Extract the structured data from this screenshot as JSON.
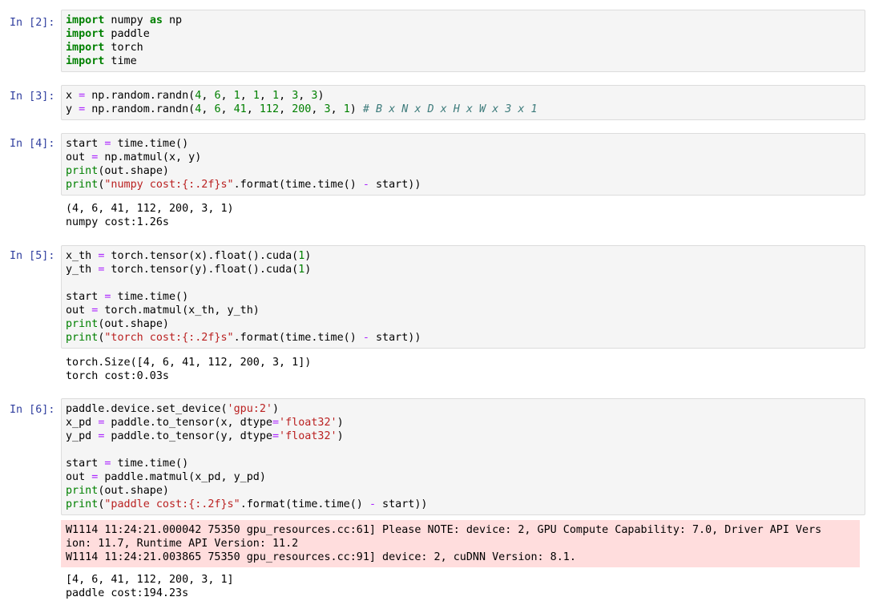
{
  "cells": [
    {
      "prompt": "In [2]:",
      "lines": [
        [
          [
            "kw",
            "import"
          ],
          [
            "t",
            " numpy "
          ],
          [
            "kw",
            "as"
          ],
          [
            "t",
            " np"
          ]
        ],
        [
          [
            "kw",
            "import"
          ],
          [
            "t",
            " paddle"
          ]
        ],
        [
          [
            "kw",
            "import"
          ],
          [
            "t",
            " torch"
          ]
        ],
        [
          [
            "kw",
            "import"
          ],
          [
            "t",
            " time"
          ]
        ]
      ],
      "output": [],
      "stderr": []
    },
    {
      "prompt": "In [3]:",
      "lines": [
        [
          [
            "t",
            "x "
          ],
          [
            "op",
            "="
          ],
          [
            "t",
            " np.random.randn("
          ],
          [
            "num",
            "4"
          ],
          [
            "t",
            ", "
          ],
          [
            "num",
            "6"
          ],
          [
            "t",
            ", "
          ],
          [
            "num",
            "1"
          ],
          [
            "t",
            ", "
          ],
          [
            "num",
            "1"
          ],
          [
            "t",
            ", "
          ],
          [
            "num",
            "1"
          ],
          [
            "t",
            ", "
          ],
          [
            "num",
            "3"
          ],
          [
            "t",
            ", "
          ],
          [
            "num",
            "3"
          ],
          [
            "t",
            ")"
          ]
        ],
        [
          [
            "t",
            "y "
          ],
          [
            "op",
            "="
          ],
          [
            "t",
            " np.random.randn("
          ],
          [
            "num",
            "4"
          ],
          [
            "t",
            ", "
          ],
          [
            "num",
            "6"
          ],
          [
            "t",
            ", "
          ],
          [
            "num",
            "41"
          ],
          [
            "t",
            ", "
          ],
          [
            "num",
            "112"
          ],
          [
            "t",
            ", "
          ],
          [
            "num",
            "200"
          ],
          [
            "t",
            ", "
          ],
          [
            "num",
            "3"
          ],
          [
            "t",
            ", "
          ],
          [
            "num",
            "1"
          ],
          [
            "t",
            ") "
          ],
          [
            "cm",
            "# B x N x D x H x W x 3 x 1"
          ]
        ]
      ],
      "output": [],
      "stderr": []
    },
    {
      "prompt": "In [4]:",
      "lines": [
        [
          [
            "t",
            "start "
          ],
          [
            "op",
            "="
          ],
          [
            "t",
            " time.time()"
          ]
        ],
        [
          [
            "t",
            "out "
          ],
          [
            "op",
            "="
          ],
          [
            "t",
            " np.matmul(x, y)"
          ]
        ],
        [
          [
            "bi",
            "print"
          ],
          [
            "t",
            "(out.shape)"
          ]
        ],
        [
          [
            "bi",
            "print"
          ],
          [
            "t",
            "("
          ],
          [
            "str",
            "\"numpy cost:{:.2f}s\""
          ],
          [
            "t",
            ".format(time.time() "
          ],
          [
            "op",
            "-"
          ],
          [
            "t",
            " start))"
          ]
        ]
      ],
      "output": [
        "(4, 6, 41, 112, 200, 3, 1)",
        "numpy cost:1.26s"
      ],
      "stderr": []
    },
    {
      "prompt": "In [5]:",
      "lines": [
        [
          [
            "t",
            "x_th "
          ],
          [
            "op",
            "="
          ],
          [
            "t",
            " torch.tensor(x).float().cuda("
          ],
          [
            "num",
            "1"
          ],
          [
            "t",
            ")"
          ]
        ],
        [
          [
            "t",
            "y_th "
          ],
          [
            "op",
            "="
          ],
          [
            "t",
            " torch.tensor(y).float().cuda("
          ],
          [
            "num",
            "1"
          ],
          [
            "t",
            ")"
          ]
        ],
        [
          [
            "t",
            ""
          ]
        ],
        [
          [
            "t",
            "start "
          ],
          [
            "op",
            "="
          ],
          [
            "t",
            " time.time()"
          ]
        ],
        [
          [
            "t",
            "out "
          ],
          [
            "op",
            "="
          ],
          [
            "t",
            " torch.matmul(x_th, y_th)"
          ]
        ],
        [
          [
            "bi",
            "print"
          ],
          [
            "t",
            "(out.shape)"
          ]
        ],
        [
          [
            "bi",
            "print"
          ],
          [
            "t",
            "("
          ],
          [
            "str",
            "\"torch cost:{:.2f}s\""
          ],
          [
            "t",
            ".format(time.time() "
          ],
          [
            "op",
            "-"
          ],
          [
            "t",
            " start))"
          ]
        ]
      ],
      "output": [
        "torch.Size([4, 6, 41, 112, 200, 3, 1])",
        "torch cost:0.03s"
      ],
      "stderr": []
    },
    {
      "prompt": "In [6]:",
      "lines": [
        [
          [
            "t",
            "paddle.device.set_device("
          ],
          [
            "str",
            "'gpu:2'"
          ],
          [
            "t",
            ")"
          ]
        ],
        [
          [
            "t",
            "x_pd "
          ],
          [
            "op",
            "="
          ],
          [
            "t",
            " paddle.to_tensor(x, dtype"
          ],
          [
            "op",
            "="
          ],
          [
            "str",
            "'float32'"
          ],
          [
            "t",
            ")"
          ]
        ],
        [
          [
            "t",
            "y_pd "
          ],
          [
            "op",
            "="
          ],
          [
            "t",
            " paddle.to_tensor(y, dtype"
          ],
          [
            "op",
            "="
          ],
          [
            "str",
            "'float32'"
          ],
          [
            "t",
            ")"
          ]
        ],
        [
          [
            "t",
            ""
          ]
        ],
        [
          [
            "t",
            "start "
          ],
          [
            "op",
            "="
          ],
          [
            "t",
            " time.time()"
          ]
        ],
        [
          [
            "t",
            "out "
          ],
          [
            "op",
            "="
          ],
          [
            "t",
            " paddle.matmul(x_pd, y_pd)"
          ]
        ],
        [
          [
            "bi",
            "print"
          ],
          [
            "t",
            "(out.shape)"
          ]
        ],
        [
          [
            "bi",
            "print"
          ],
          [
            "t",
            "("
          ],
          [
            "str",
            "\"paddle cost:{:.2f}s\""
          ],
          [
            "t",
            ".format(time.time() "
          ],
          [
            "op",
            "-"
          ],
          [
            "t",
            " start))"
          ]
        ]
      ],
      "stderr": [
        "W1114 11:24:21.000042 75350 gpu_resources.cc:61] Please NOTE: device: 2, GPU Compute Capability: 7.0, Driver API Vers",
        "ion: 11.7, Runtime API Version: 11.2",
        "W1114 11:24:21.003865 75350 gpu_resources.cc:91] device: 2, cuDNN Version: 8.1."
      ],
      "output": [
        "[4, 6, 41, 112, 200, 3, 1]",
        "paddle cost:194.23s"
      ]
    }
  ],
  "colors": {
    "prompt": "#303f9f",
    "keyword": "#008000",
    "number": "#008000",
    "string": "#ba2121",
    "operator": "#aa22ff",
    "comment": "#3d7b7b",
    "cell_bg": "#f5f5f5",
    "stderr_bg": "#ffdddd"
  }
}
